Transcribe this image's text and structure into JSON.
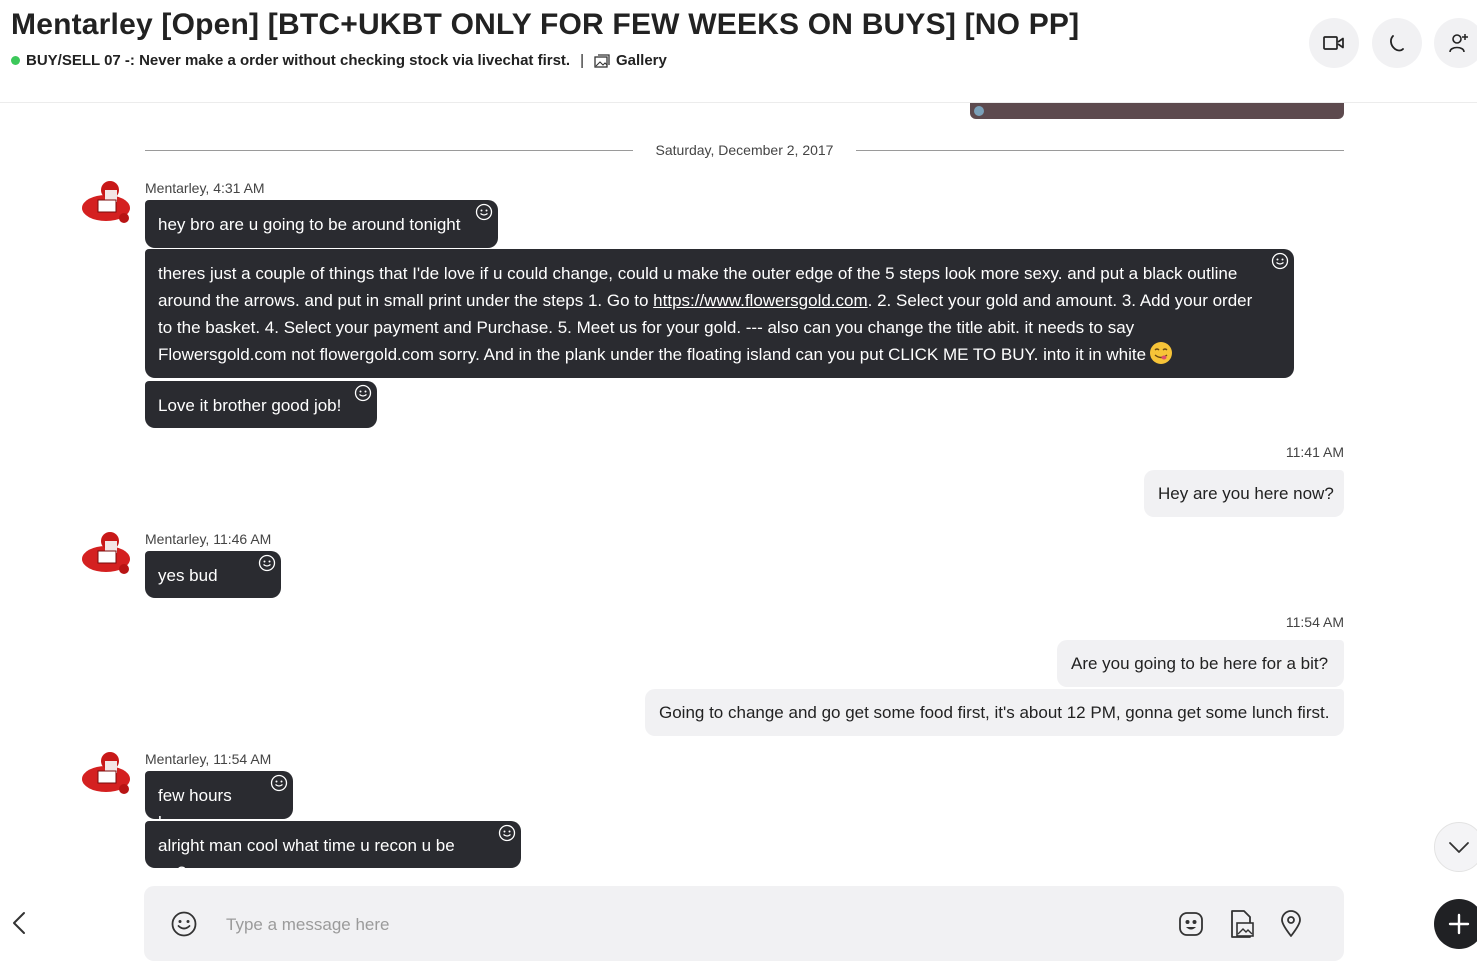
{
  "header": {
    "title": "Mentarley [Open] [BTC+UKBT ONLY FOR FEW WEEKS ON BUYS] [NO PP]",
    "status_text": "BUY/SELL 07 -: Never make a order without checking stock via livechat first.",
    "separator": "|",
    "gallery_label": "Gallery",
    "status_color": "#3cc85a"
  },
  "date_divider": "Saturday, December 2, 2017",
  "groups": [
    {
      "sender": "Mentarley, 4:31 AM",
      "messages": [
        "hey bro are u going to be around tonight",
        {
          "before_link": "theres just a couple of things that I'de love if u could change, could u make the outer edge of the 5 steps look more sexy. and put a black outline around the arrows. and put in small print under the steps 1. Go to ",
          "link": "https://www.flowersgold.com",
          "after_link": ". 2. Select your gold and amount. 3. Add your order to the basket. 4. Select your payment and Purchase. 5. Meet us for your gold. --- also can you change the title abit. it needs to say Flowersgold.com not flowergold.com sorry. And in the plank under the floating island can you put CLICK ME TO BUY. into it in white",
          "emoji": "smiling-face-savoring-food"
        },
        "Love it brother good job!"
      ]
    },
    {
      "outgoing_time": "11:41 AM",
      "outgoing": [
        "Hey are you here now?"
      ]
    },
    {
      "sender": "Mentarley, 11:46 AM",
      "messages": [
        "yes bud"
      ]
    },
    {
      "outgoing_time": "11:54 AM",
      "outgoing": [
        "Are you going to be here for a bit?",
        "Going to change and go get some food first, it's about 12 PM, gonna get some lunch first."
      ]
    },
    {
      "sender": "Mentarley, 11:54 AM",
      "messages": [
        "few hours bro",
        "alright man cool what time u recon u be on?"
      ]
    }
  ],
  "composer": {
    "placeholder": "Type a message here"
  },
  "colors": {
    "incoming_bubble": "#2a2b30",
    "outgoing_bubble": "#f1f1f3",
    "accent_dark": "#202124"
  }
}
